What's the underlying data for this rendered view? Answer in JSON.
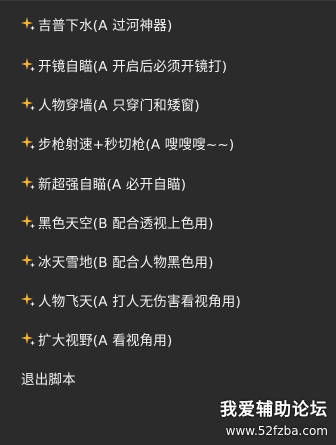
{
  "menu": {
    "items": [
      {
        "label": "吉普下水(A 过河神器)",
        "icon": "sparkle-icon"
      },
      {
        "label": "开镜自瞄(A 开启后必须开镜打)",
        "icon": "sparkle-icon"
      },
      {
        "label": "人物穿墙(A 只穿门和矮窗)",
        "icon": "sparkle-icon"
      },
      {
        "label": "步枪射速+秒切枪(A 嗖嗖嗖~~)",
        "icon": "sparkle-icon"
      },
      {
        "label": "新超强自瞄(A 必开自瞄)",
        "icon": "sparkle-icon"
      },
      {
        "label": "黑色天空(B 配合透视上色用)",
        "icon": "sparkle-icon"
      },
      {
        "label": "冰天雪地(B 配合人物黑色用)",
        "icon": "sparkle-icon"
      },
      {
        "label": "人物飞天(A 打人无伤害看视角用)",
        "icon": "sparkle-icon"
      },
      {
        "label": "扩大视野(A 看视角用)",
        "icon": "sparkle-icon"
      }
    ],
    "exit_label": "退出脚本"
  },
  "watermark": {
    "title": "我爱辅助论坛",
    "url": "www.52fzba.com"
  },
  "colors": {
    "background": "#2b2b2b",
    "text": "#f2f2f2",
    "icon_gold": "#f0b23a",
    "icon_white": "#ffffff"
  }
}
